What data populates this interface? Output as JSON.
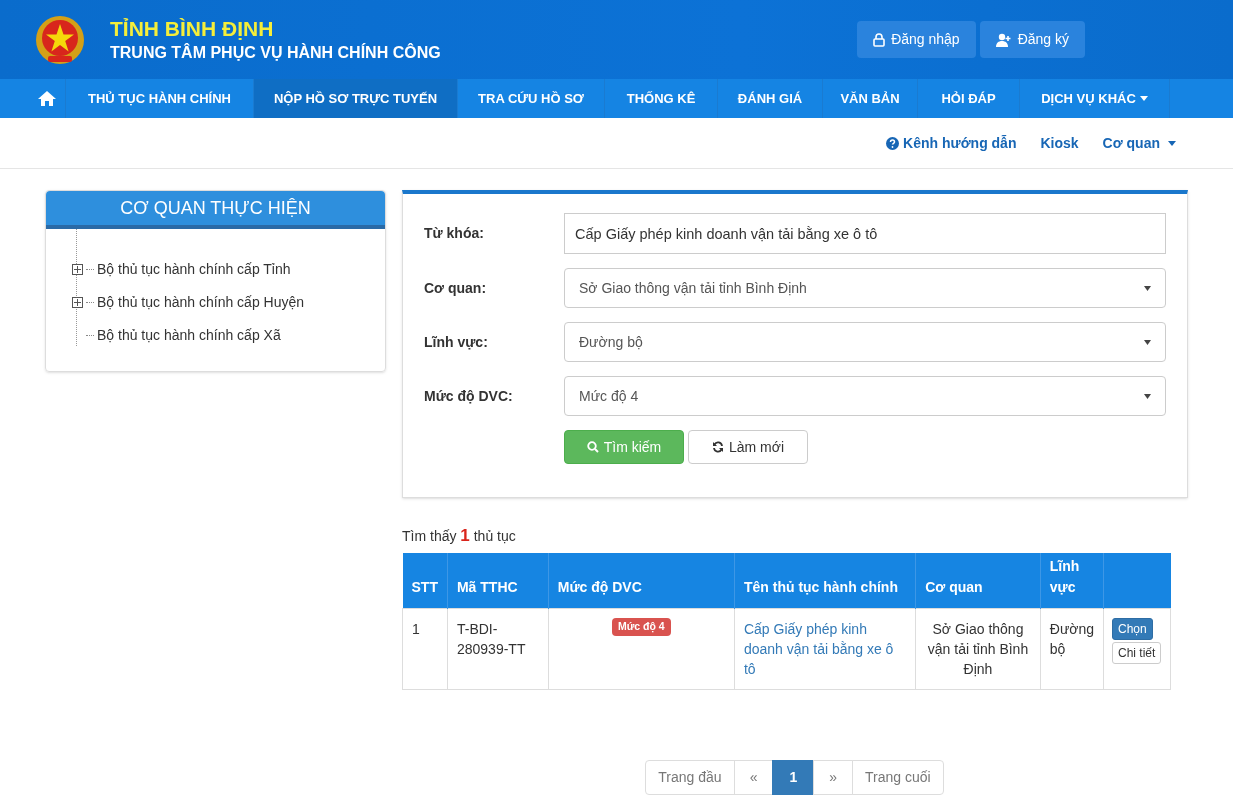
{
  "header": {
    "title": "TỈNH BÌNH ĐỊNH",
    "subtitle": "TRUNG TÂM PHỤC VỤ HÀNH CHÍNH CÔNG",
    "buttons": [
      {
        "kind": "login",
        "label": "Đăng nhập"
      },
      {
        "kind": "register",
        "label": "Đăng ký"
      }
    ]
  },
  "nav": [
    {
      "kind": "home",
      "selected": false
    },
    {
      "kind": "link",
      "label": "THỦ TỤC HÀNH CHÍNH",
      "selected": false
    },
    {
      "kind": "link",
      "label": "NỘP HỒ SƠ TRỰC TUYẾN",
      "selected": true
    },
    {
      "kind": "link",
      "label": "TRA CỨU HỒ SƠ",
      "selected": false
    },
    {
      "kind": "link",
      "label": "THỐNG KÊ",
      "selected": false
    },
    {
      "kind": "link",
      "label": "ĐÁNH GIÁ",
      "selected": false
    },
    {
      "kind": "link",
      "label": "VĂN BẢN",
      "selected": false
    },
    {
      "kind": "link",
      "label": "HỎI ĐÁP",
      "selected": false
    },
    {
      "kind": "dropdown",
      "label": "DỊCH VỤ KHÁC",
      "selected": false
    }
  ],
  "subnav": [
    {
      "kind": "help",
      "label": "Kênh hướng dẫn"
    },
    {
      "kind": "link",
      "label": "Kiosk"
    },
    {
      "kind": "dropdown",
      "label": "Cơ quan"
    }
  ],
  "sidebar": {
    "title": "CƠ QUAN THỰC HIỆN",
    "tree": [
      {
        "label": "Bộ thủ tục hành chính cấp Tỉnh",
        "kind": "folder",
        "expanded": false
      },
      {
        "label": "Bộ thủ tục hành chính cấp Huyện",
        "kind": "folder",
        "expanded": false
      },
      {
        "label": "Bộ thủ tục hành chính cấp Xã",
        "kind": "leaf"
      }
    ]
  },
  "search_form": {
    "fields": [
      {
        "kind": "input",
        "label": "Từ khóa:",
        "value": "Cấp Giấy phép kinh doanh vận tải bằng xe ô tô"
      },
      {
        "kind": "select",
        "label": "Cơ quan:",
        "value": "Sở Giao thông vận tải tỉnh Bình Định"
      },
      {
        "kind": "select",
        "label": "Lĩnh vực:",
        "value": "Đường bộ"
      },
      {
        "kind": "select",
        "label": "Mức độ DVC:",
        "value": "Mức độ 4"
      }
    ],
    "buttons": [
      {
        "kind": "search",
        "label": "Tìm kiếm"
      },
      {
        "kind": "reset",
        "label": "Làm mới"
      }
    ]
  },
  "result_summary": "Tìm thấy **1** thủ tục",
  "table": {
    "columns": [
      "STT",
      "Mã TTHC",
      "Mức độ DVC",
      "Tên thủ tục hành chính",
      "Cơ quan",
      "Lĩnh vực"
    ],
    "rows": [
      {
        "stt": "1",
        "code": "T-BDI-280939-TT",
        "level": "Mức độ 4",
        "name": "Cấp Giấy phép kinh doanh vận tải bằng xe ô tô",
        "agency": "Sở Giao thông vận tải tỉnh Bình Định",
        "field": "Đường bộ",
        "actions": [
          "Chọn",
          "Chi tiết"
        ]
      }
    ]
  },
  "pagination": [
    {
      "kind": "text",
      "label": "Trang đầu",
      "selected": false
    },
    {
      "kind": "arrow",
      "label": "«",
      "selected": false
    },
    {
      "kind": "page",
      "label": "1",
      "selected": true
    },
    {
      "kind": "arrow",
      "label": "»",
      "selected": false
    },
    {
      "kind": "text",
      "label": "Trang cuối",
      "selected": false
    }
  ]
}
